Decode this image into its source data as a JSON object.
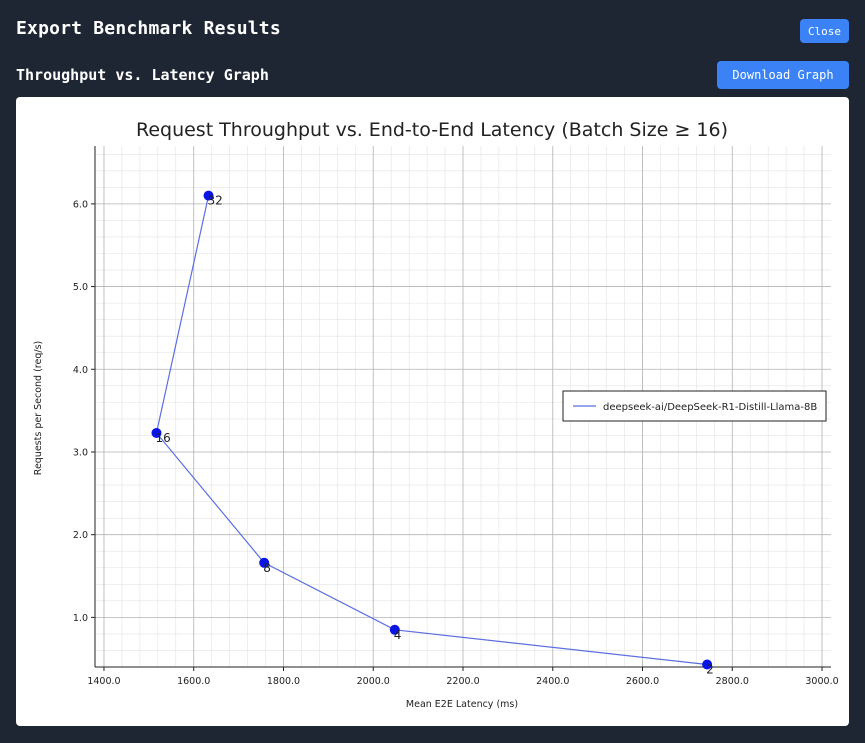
{
  "modal": {
    "title": "Export Benchmark Results",
    "close_label": "Close"
  },
  "section": {
    "title": "Throughput vs. Latency Graph",
    "download_label": "Download Graph"
  },
  "chart_data": {
    "type": "line",
    "title": "Request Throughput vs. End-to-End Latency (Batch Size ≥ 16)",
    "xlabel": "Mean E2E Latency (ms)",
    "ylabel": "Requests per Second (req/s)",
    "xlim": [
      1380,
      3020
    ],
    "ylim": [
      0.4,
      6.7
    ],
    "xticks": [
      1400,
      1600,
      1800,
      2000,
      2200,
      2400,
      2600,
      2800,
      3000
    ],
    "xtick_labels": [
      "1400.0",
      "1600.0",
      "1800.0",
      "2000.0",
      "2200.0",
      "2400.0",
      "2600.0",
      "2800.0",
      "3000.0"
    ],
    "yticks": [
      1,
      2,
      3,
      4,
      5,
      6
    ],
    "ytick_labels": [
      "1.0",
      "2.0",
      "3.0",
      "4.0",
      "5.0",
      "6.0"
    ],
    "grid": true,
    "legend_position": "center-right",
    "line_color": "#5b6fe0",
    "marker_color": "#0a14e6",
    "series": [
      {
        "name": "deepseek-ai/DeepSeek-R1-Distill-Llama-8B",
        "points": [
          {
            "x": 1633,
            "y": 6.1,
            "label": "32"
          },
          {
            "x": 1517,
            "y": 3.23,
            "label": "16"
          },
          {
            "x": 1757,
            "y": 1.66,
            "label": "8"
          },
          {
            "x": 2048,
            "y": 0.85,
            "label": "4"
          },
          {
            "x": 2744,
            "y": 0.43,
            "label": "2"
          }
        ]
      }
    ]
  }
}
